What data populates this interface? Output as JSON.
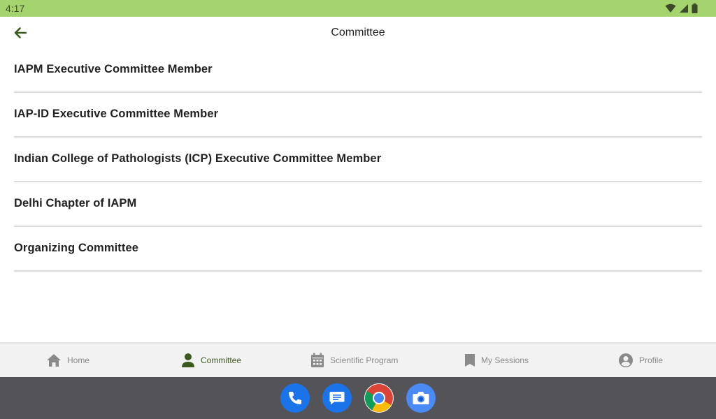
{
  "status_bar": {
    "time": "4:17"
  },
  "app_bar": {
    "title": "Committee"
  },
  "committees": [
    {
      "label": "IAPM Executive Committee Member"
    },
    {
      "label": "IAP-ID Executive Committee Member"
    },
    {
      "label": "Indian College of Pathologists (ICP) Executive Committee Member"
    },
    {
      "label": "Delhi Chapter of IAPM"
    },
    {
      "label": "Organizing Committee"
    }
  ],
  "bottom_nav": {
    "items": [
      {
        "label": "Home",
        "icon": "home-icon"
      },
      {
        "label": "Committee",
        "icon": "person-icon",
        "active": true
      },
      {
        "label": "Scientific Program",
        "icon": "calendar-icon"
      },
      {
        "label": "My Sessions",
        "icon": "bookmark-icon"
      },
      {
        "label": "Profile",
        "icon": "account-circle-icon"
      }
    ]
  },
  "dock": {
    "apps": [
      "phone",
      "messages",
      "chrome",
      "camera"
    ]
  },
  "colors": {
    "status_bar": "#a5d46f",
    "accent": "#3c5a1e",
    "nav_bar": "#535358",
    "divider": "#dcdcdc"
  }
}
